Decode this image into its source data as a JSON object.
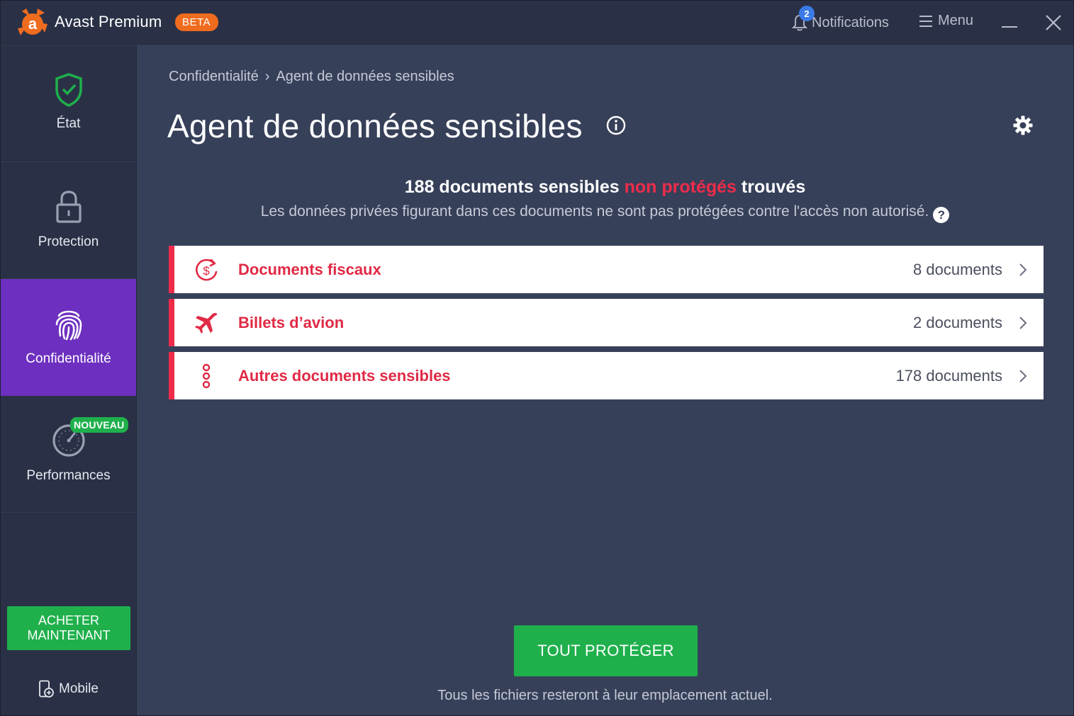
{
  "app": {
    "title": "Avast Premium",
    "badge": "BETA",
    "logo_letter": "a",
    "brand_color": "#ef6c1f"
  },
  "titlebar": {
    "notifications_label": "Notifications",
    "notifications_count": "2",
    "menu_label": "Menu"
  },
  "sidebar": {
    "items": [
      {
        "label": "État",
        "icon": "shield-check-icon",
        "active": false
      },
      {
        "label": "Protection",
        "icon": "lock-icon",
        "active": false
      },
      {
        "label": "Confidentialité",
        "icon": "fingerprint-icon",
        "active": true
      },
      {
        "label": "Performances",
        "icon": "speedometer-icon",
        "active": false,
        "badge": "NOUVEAU"
      }
    ],
    "buy_label_1": "ACHETER",
    "buy_label_2": "MAINTENANT",
    "mobile_label": "Mobile"
  },
  "breadcrumb": {
    "parent": "Confidentialité",
    "separator": "›",
    "current": "Agent de données sensibles"
  },
  "main": {
    "title": "Agent de données sensibles",
    "summary_part1": "188 documents sensibles",
    "summary_highlight": "non protégés",
    "summary_part2": "trouvés",
    "subtitle": "Les données privées figurant dans ces documents ne sont pas protégées contre l'accès non autorisé.",
    "help_glyph": "?",
    "rows": [
      {
        "title": "Documents fiscaux",
        "count": "8 documents",
        "icon": "dollar-refresh-icon"
      },
      {
        "title": "Billets d’avion",
        "count": "2 documents",
        "icon": "airplane-icon"
      },
      {
        "title": "Autres documents sensibles",
        "count": "178 documents",
        "icon": "dots-vertical-icon"
      }
    ],
    "protect_button": "TOUT PROTÉGER",
    "footnote": "Tous les fichiers resteront à leur emplacement actuel."
  },
  "colors": {
    "accent_red": "#ee2c4a",
    "active_purple": "#6d2fbf",
    "success_green": "#1fb04c",
    "background": "#374059",
    "sidebar": "#2a3146"
  }
}
